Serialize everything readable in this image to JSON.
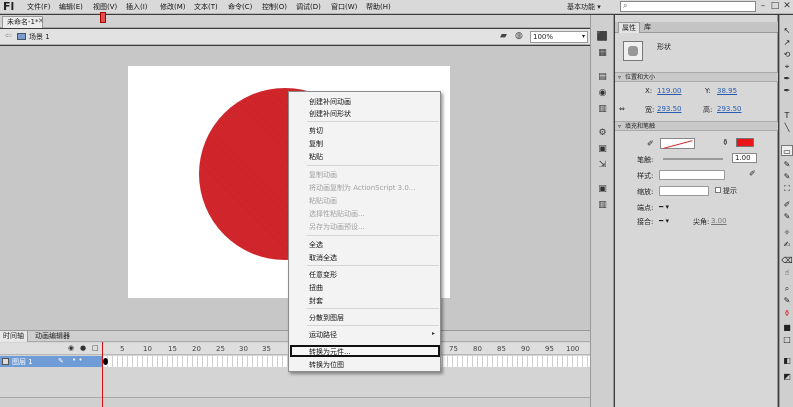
{
  "app": {
    "logo": "Fl"
  },
  "menu": [
    "文件(F)",
    "编辑(E)",
    "视图(V)",
    "插入(I)",
    "修改(M)",
    "文本(T)",
    "命令(C)",
    "控制(O)",
    "调试(D)",
    "窗口(W)",
    "帮助(H)"
  ],
  "workspace": {
    "label": "基本功能",
    "chevron": "▾"
  },
  "search": {
    "value": "",
    "icon": "search-icon",
    "glyph": "⌕"
  },
  "window_controls": {
    "minimize": "–",
    "maximize": "□",
    "close": "✕"
  },
  "document": {
    "tab_title": "未命名-1*",
    "close": "✕"
  },
  "editbar": {
    "scene": "场景 1",
    "zoom": "100%",
    "back": "⇦",
    "chevron": "▾",
    "symbol_glyph": "▰",
    "scene_glyph": "◍"
  },
  "timeline": {
    "tabs": [
      "时间轴",
      "动画编辑器"
    ],
    "header_controls": [
      "◉",
      "●",
      "□"
    ],
    "frame_numbers": [
      "5",
      "10",
      "15",
      "20",
      "25",
      "30",
      "35",
      "75",
      "80",
      "85",
      "90",
      "95",
      "100"
    ],
    "layer_name": "图层 1",
    "layer_pencil": "✎",
    "layer_dots": "• •",
    "current_frame": 1
  },
  "context_menu": {
    "items": [
      {
        "label": "创建补间动画",
        "disabled": false
      },
      {
        "label": "创建补间形状",
        "disabled": false
      },
      {
        "label": "剪切",
        "disabled": false
      },
      {
        "label": "复制",
        "disabled": false
      },
      {
        "label": "粘贴",
        "disabled": false
      },
      {
        "label": "复制动画",
        "disabled": true
      },
      {
        "label": "将动画复制为 ActionScript 3.0...",
        "disabled": true
      },
      {
        "label": "粘贴动画",
        "disabled": true
      },
      {
        "label": "选择性粘贴动画...",
        "disabled": true
      },
      {
        "label": "另存为动画预设...",
        "disabled": true
      },
      {
        "label": "全选",
        "disabled": false
      },
      {
        "label": "取消全选",
        "disabled": false
      },
      {
        "label": "任意变形",
        "disabled": false
      },
      {
        "label": "扭曲",
        "disabled": false
      },
      {
        "label": "封套",
        "disabled": false
      },
      {
        "label": "分散到图层",
        "disabled": false
      },
      {
        "label": "运动路径",
        "disabled": false
      },
      {
        "label": "转换为元件...",
        "disabled": false
      },
      {
        "label": "转换为位图",
        "disabled": false
      }
    ],
    "submenu_arrow": "▸"
  },
  "properties": {
    "tabs": [
      "属性",
      "库"
    ],
    "type_label": "形状",
    "position_section": "位置和大小",
    "fill_section": "填充和笔触",
    "x_label": "X:",
    "x_value": "119.00",
    "y_label": "Y:",
    "y_value": "38.95",
    "w_label": "宽:",
    "w_value": "293.50",
    "h_label": "高:",
    "h_value": "293.50",
    "link_glyph": "⇔",
    "section_toggle": "▿",
    "pencil_glyph": "✐",
    "bucket_glyph": "⚱",
    "stroke_label": "笔触:",
    "stroke_value": "1.00",
    "style_label": "样式:",
    "scale_label": "缩放:",
    "hint_label": "提示",
    "cap_label": "端点:",
    "cap_value": "━ ▾",
    "join_label": "接合:",
    "join_value": "━ ▾",
    "miter_label": "尖角:",
    "miter_value": "3.00",
    "fill_color": "#e8151b"
  },
  "tool_strip": [
    "⬛",
    "▦",
    "▤",
    "◉",
    "▥",
    "⚙",
    "▣",
    "⇲",
    "▣",
    "▥"
  ],
  "right_tools": [
    "↖",
    "↗",
    "⟲",
    "⌖",
    "✒",
    "T",
    "╲",
    "▭",
    "✎",
    "✎",
    "⛶",
    "✐",
    "✎",
    "✧",
    "✍",
    "⌫",
    "☝",
    "⌕",
    "✎",
    "⚱",
    "■",
    "□",
    "◧",
    "◩",
    "⊘"
  ]
}
